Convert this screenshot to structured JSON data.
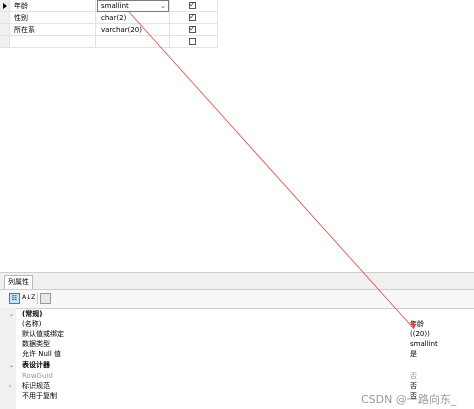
{
  "columns": [
    {
      "name": "年龄",
      "type": "smallint",
      "allow_null": true,
      "selected": true
    },
    {
      "name": "性别",
      "type": "char(2)",
      "allow_null": true
    },
    {
      "name": "所在系",
      "type": "varchar(20)",
      "allow_null": true
    },
    {
      "name": "",
      "type": "",
      "allow_null": false
    }
  ],
  "properties_panel": {
    "tab_label": "列属性",
    "sort_icon_label": "A↓Z",
    "rows": [
      {
        "kind": "category",
        "name": "(常规)",
        "value": "",
        "expander": "⌄"
      },
      {
        "kind": "prop",
        "name": "(名称)",
        "value": "年龄"
      },
      {
        "kind": "prop",
        "name": "默认值或绑定",
        "value": "((20))"
      },
      {
        "kind": "prop",
        "name": "数据类型",
        "value": "smallint"
      },
      {
        "kind": "prop",
        "name": "允许 Null 值",
        "value": "是"
      },
      {
        "kind": "category",
        "name": "表设计器",
        "value": "",
        "expander": "⌄"
      },
      {
        "kind": "prop",
        "name": "RowGuid",
        "value": "否",
        "muted": true
      },
      {
        "kind": "prop",
        "name": "标识规范",
        "value": "否",
        "expander": "›"
      },
      {
        "kind": "prop",
        "name": "不用于复制",
        "value": "否"
      }
    ]
  },
  "watermark": "CSDN @一路向东_",
  "colors": {
    "annotation_line": "#e8453c",
    "selection_box": "#3c7fb1"
  }
}
